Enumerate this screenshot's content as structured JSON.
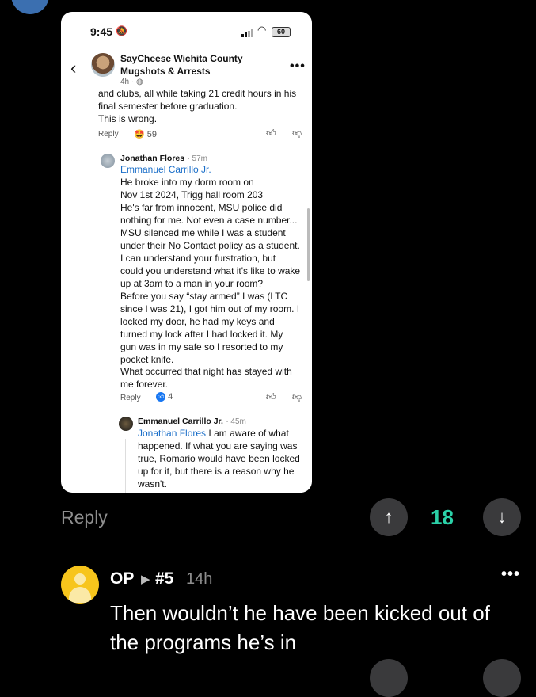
{
  "status_bar": {
    "time": "9:45",
    "battery": "60"
  },
  "post_header": {
    "title_line1": "SayCheese Wichita County",
    "title_line2": "Mugshots & Arrests",
    "age": "4h ·"
  },
  "comment_top": {
    "lines": [
      "and clubs, all while taking 21 credit hours in his",
      "final semester before graduation.",
      "This is wrong."
    ],
    "reply_label": "Reply",
    "reaction_count": "59"
  },
  "comment_reply": {
    "author": "Jonathan Flores",
    "time": "· 57m",
    "mention": "Emmanuel Carrillo Jr.",
    "lines": [
      "He broke into my dorm room on",
      "Nov 1st 2024, Trigg hall room 203",
      "He's far from innocent, MSU police did",
      "nothing for me. Not even a case number...",
      "MSU silenced me while I was a student",
      "under their No Contact policy as a student.",
      "I can understand your furstration, but",
      "could you understand what it's like to wake",
      "up at 3am to a man in your room?",
      "Before you say “stay armed” I was (LTC",
      "since I was 21), I got him out of my room. I",
      "locked my door, he had my keys and",
      "turned my lock after I had locked it. My",
      "gun was in my safe so I resorted to my",
      "pocket knife.",
      "What occurred that night has stayed with",
      "me forever."
    ],
    "reply_label": "Reply",
    "reaction_count": "4"
  },
  "comment_nested": {
    "author": "Emmanuel Carrillo Jr.",
    "time": "· 45m",
    "mention": "Jonathan Flores",
    "first_line_rest": " I am aware of what",
    "lines": [
      "happened. If what you are saying was",
      "true, Romario would have been locked",
      "up for it, but there is a reason why he",
      "wasn't."
    ]
  },
  "thread_actions": {
    "reply_label": "Reply",
    "vote_count": "18"
  },
  "op_comment": {
    "author": "OP",
    "thread_ref": "#5",
    "age": "14h",
    "text": "Then wouldn’t he have been kicked out of the programs he’s in"
  },
  "colors": {
    "accent_teal": "#2bd1a8",
    "link_blue": "#1a6ec8",
    "op_avatar": "#f7c51c"
  }
}
